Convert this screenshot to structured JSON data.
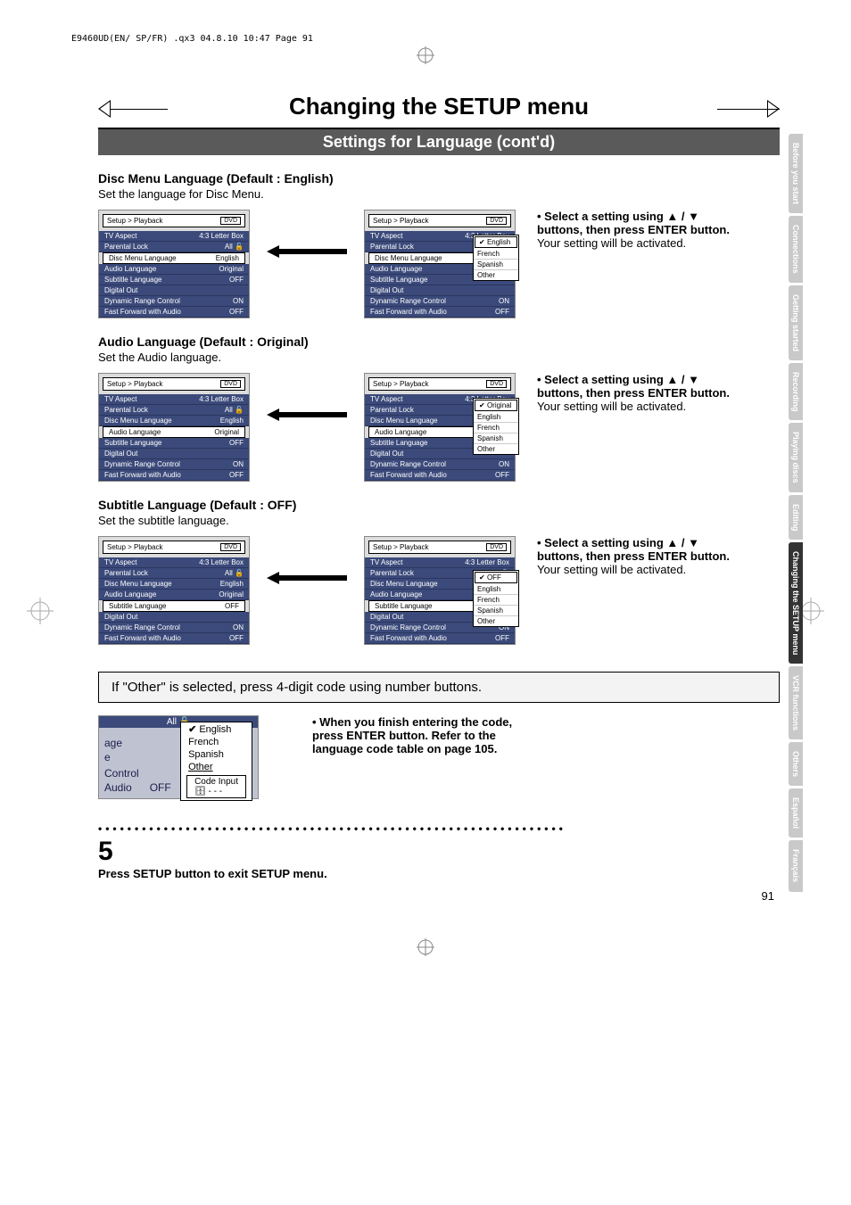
{
  "header_line": "E9460UD(EN/ SP/FR)  .qx3  04.8.10  10:47  Page 91",
  "title": "Changing the SETUP menu",
  "subtitle": "Settings for Language (cont'd)",
  "sections": [
    {
      "heading": "Disc Menu Language (Default : English)",
      "sub": "Set the language for Disc Menu.",
      "options": [
        "English",
        "French",
        "Spanish",
        "Other"
      ],
      "selected": "English"
    },
    {
      "heading": "Audio Language (Default : Original)",
      "sub": "Set the Audio language.",
      "options": [
        "Original",
        "English",
        "French",
        "Spanish",
        "Other"
      ],
      "selected": "Original"
    },
    {
      "heading": "Subtitle Language (Default : OFF)",
      "sub": "Set the subtitle language.",
      "options": [
        "OFF",
        "English",
        "French",
        "Spanish",
        "Other"
      ],
      "selected": "OFF"
    }
  ],
  "menu": {
    "breadcrumb": "Setup > Playback",
    "badge": "DVD",
    "rows": [
      {
        "label": "TV Aspect",
        "value": "4:3 Letter Box"
      },
      {
        "label": "Parental Lock",
        "value": "All  🔓"
      },
      {
        "label": "Disc Menu Language",
        "value": "English"
      },
      {
        "label": "Audio Language",
        "value": "Original"
      },
      {
        "label": "Subtitle Language",
        "value": "OFF"
      },
      {
        "label": "Digital Out",
        "value": ""
      },
      {
        "label": "Dynamic Range Control",
        "value": "ON"
      },
      {
        "label": "Fast Forward with Audio",
        "value": "OFF"
      }
    ]
  },
  "instruction": {
    "line1": "• Select a setting using ▲ / ▼ buttons, then press ENTER button.",
    "line2": "Your setting will be activated."
  },
  "note_box": "If \"Other\" is selected, press 4-digit code using number buttons.",
  "other_zoom": {
    "top_strip": "All   🔓",
    "left_labels": [
      "age",
      "e",
      "",
      "Control",
      "Audio"
    ],
    "options": [
      "English",
      "French",
      "Spanish",
      "Other"
    ],
    "code_label": "Code Input",
    "code_value": "- - -",
    "bottom_value": "OFF"
  },
  "other_instruction": "• When you finish entering the code, press ENTER button. Refer to the language code table on page 105.",
  "step5_num": "5",
  "step5_text": "Press SETUP button to exit SETUP menu.",
  "tabs": [
    "Before you start",
    "Connections",
    "Getting started",
    "Recording",
    "Playing discs",
    "Editing",
    "Changing the SETUP menu",
    "VCR functions",
    "Others",
    "Español",
    "Français"
  ],
  "active_tab_index": 6,
  "page_number": "91"
}
